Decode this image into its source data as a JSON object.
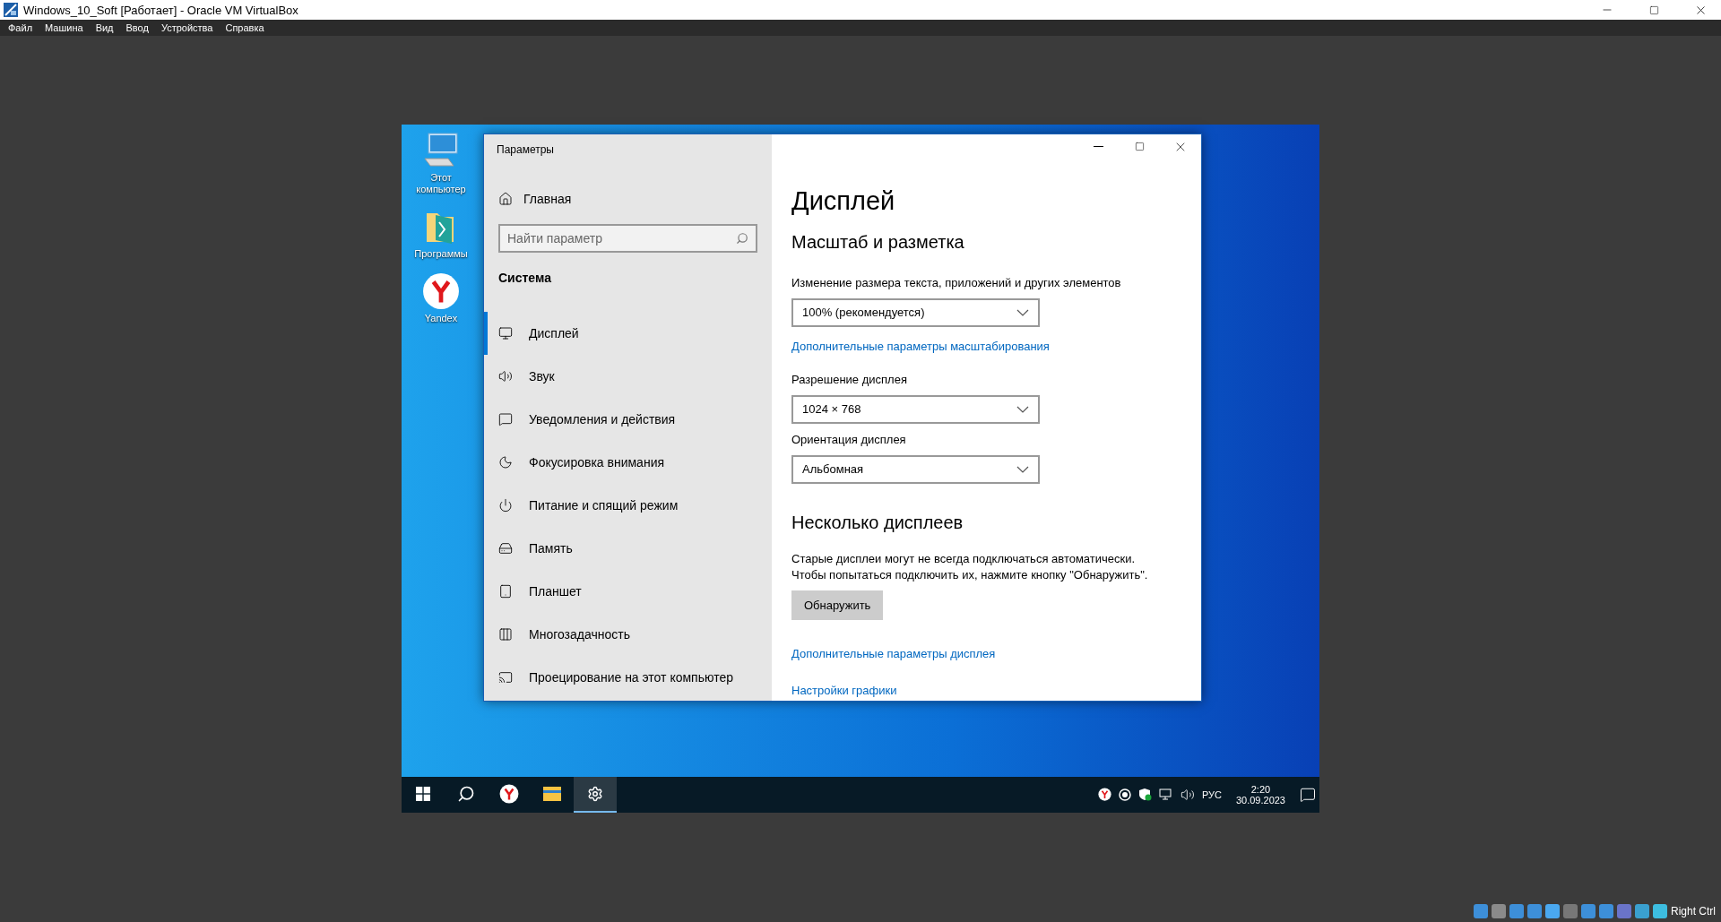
{
  "host_window": {
    "title": "Windows_10_Soft [Работает] - Oracle VM VirtualBox"
  },
  "menu": [
    "Файл",
    "Машина",
    "Вид",
    "Ввод",
    "Устройства",
    "Справка"
  ],
  "desktop_icons": [
    {
      "label": "Этот компьютер",
      "kind": "computer"
    },
    {
      "label": "Программы",
      "kind": "folder"
    },
    {
      "label": "Yandex",
      "kind": "yandex"
    }
  ],
  "settings": {
    "title": "Параметры",
    "home": "Главная",
    "search": {
      "placeholder": "Найти параметр"
    },
    "section": "Система",
    "nav": [
      {
        "label": "Дисплей",
        "selected": true
      },
      {
        "label": "Звук",
        "selected": false
      },
      {
        "label": "Уведомления и действия",
        "selected": false
      },
      {
        "label": "Фокусировка внимания",
        "selected": false
      },
      {
        "label": "Питание и спящий режим",
        "selected": false
      },
      {
        "label": "Память",
        "selected": false
      },
      {
        "label": "Планшет",
        "selected": false
      },
      {
        "label": "Многозадачность",
        "selected": false
      },
      {
        "label": "Проецирование на этот компьютер",
        "selected": false
      }
    ],
    "page_title": "Дисплей",
    "content": [
      {
        "kind": "heading",
        "text": "Масштаб и разметка"
      },
      {
        "kind": "label",
        "text": "Изменение размера текста, приложений и других элементов"
      },
      {
        "kind": "dropdown",
        "text": "100% (рекомендуется)"
      },
      {
        "kind": "link",
        "text": "Дополнительные параметры масштабирования"
      },
      {
        "kind": "label",
        "text": "Разрешение дисплея"
      },
      {
        "kind": "dropdown",
        "text": "1024 × 768"
      },
      {
        "kind": "label",
        "text": "Ориентация дисплея"
      },
      {
        "kind": "dropdown",
        "text": "Альбомная"
      },
      {
        "kind": "heading",
        "text": "Несколько дисплеев"
      },
      {
        "kind": "text",
        "lines": [
          "Старые дисплеи могут не всегда подключаться автоматически.",
          "Чтобы попытаться подключить их, нажмите кнопку \"Обнаружить\"."
        ]
      },
      {
        "kind": "button",
        "text": "Обнаружить"
      },
      {
        "kind": "link",
        "text": "Дополнительные параметры дисплея"
      },
      {
        "kind": "link",
        "text": "Настройки графики"
      }
    ]
  },
  "taskbar": {
    "apps": [
      {
        "kind": "start",
        "selected": false
      },
      {
        "kind": "search",
        "selected": false
      },
      {
        "kind": "yandex",
        "selected": false
      },
      {
        "kind": "explorer",
        "selected": false
      },
      {
        "kind": "settings",
        "selected": true
      }
    ],
    "language": "РУС",
    "time": "2:20",
    "date": "30.09.2023"
  },
  "status_bar": {
    "host_key": "Right Ctrl"
  }
}
